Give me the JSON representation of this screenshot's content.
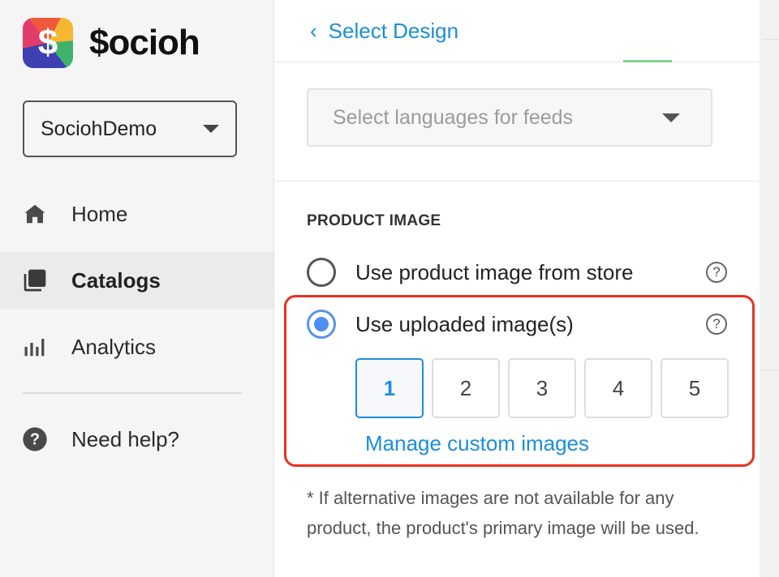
{
  "sidebar": {
    "logo_mark": "$",
    "logo_text": "$ocioh",
    "account": {
      "value": "SociohDemo"
    },
    "nav": [
      {
        "label": "Home",
        "icon": "home-icon"
      },
      {
        "label": "Catalogs",
        "icon": "catalogs-icon",
        "active": true
      },
      {
        "label": "Analytics",
        "icon": "analytics-icon"
      },
      {
        "label": "Need help?",
        "icon": "help-circle-icon"
      }
    ]
  },
  "panel": {
    "back_label": "Select Design",
    "languages": {
      "placeholder": "Select languages for feeds"
    },
    "product_image": {
      "title": "PRODUCT IMAGE",
      "options": [
        {
          "label": "Use product image from store",
          "selected": false
        },
        {
          "label": "Use uploaded image(s)",
          "selected": true
        }
      ],
      "image_slots": [
        "1",
        "2",
        "3",
        "4",
        "5"
      ],
      "selected_slot": "1",
      "manage_link": "Manage custom images",
      "footnote": "* If alternative images are not available for any product, the product's primary image will be used."
    }
  },
  "colors": {
    "accent": "#1a8fd6",
    "radio_selected": "#4f8ff0",
    "highlight": "#e8321f"
  }
}
